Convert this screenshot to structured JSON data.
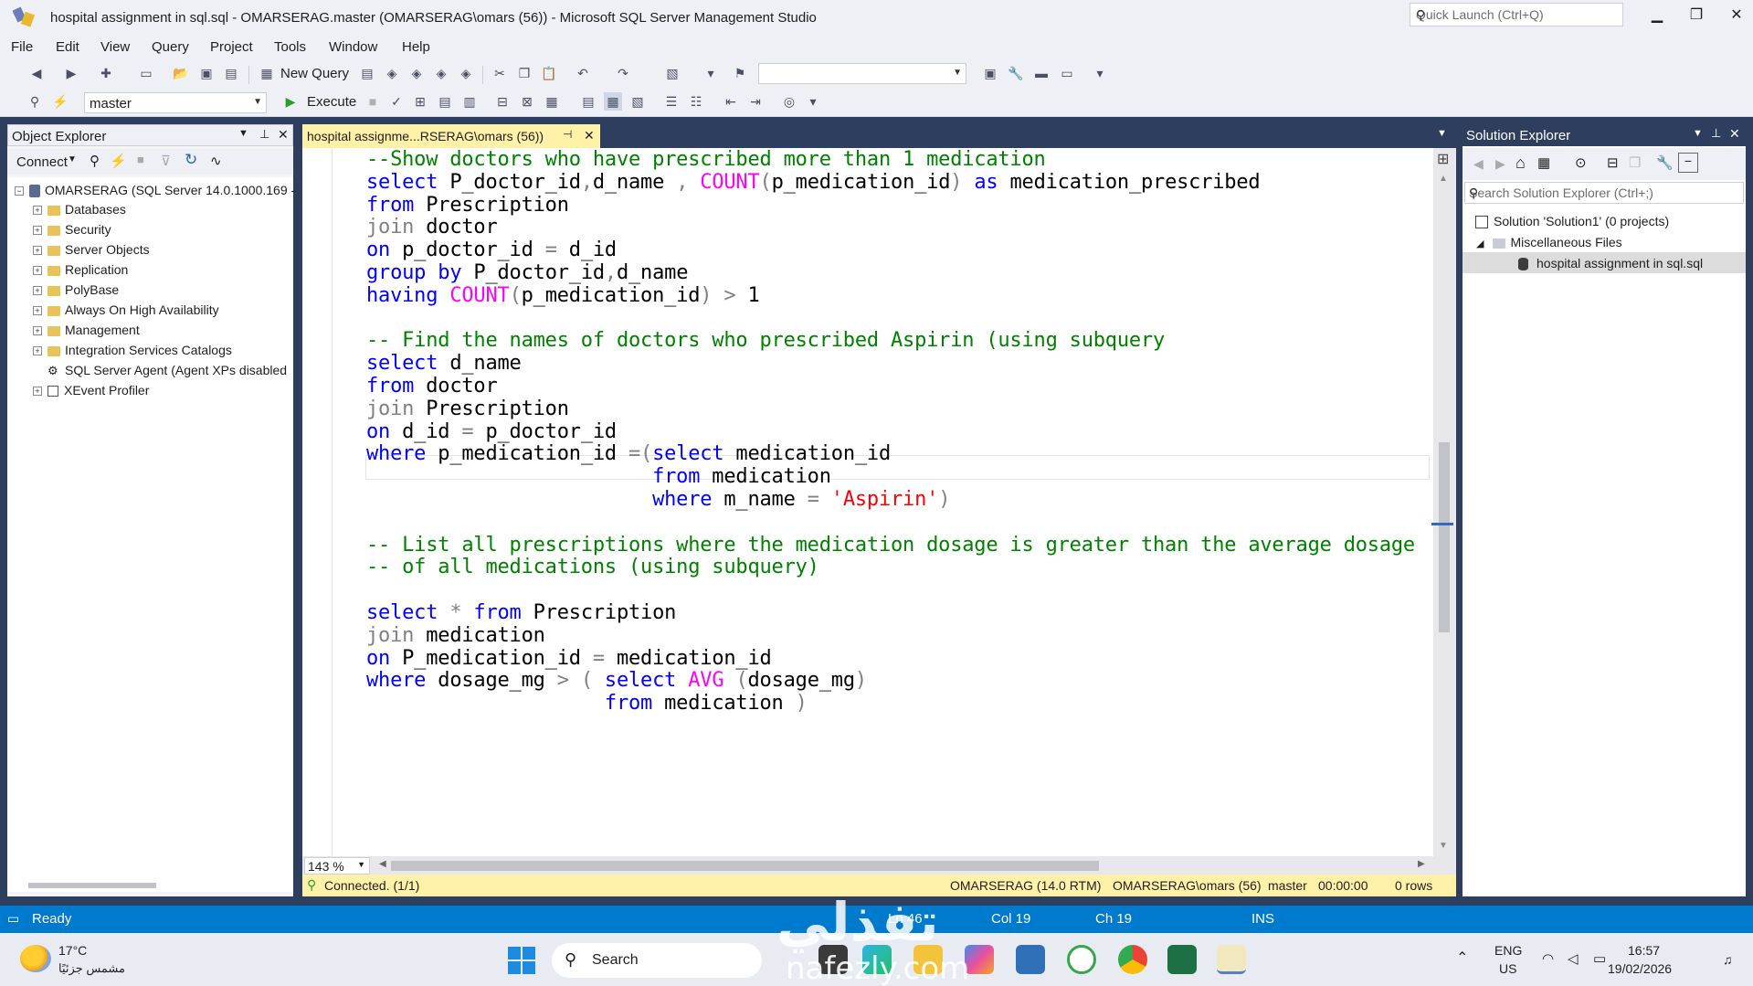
{
  "window": {
    "title": "hospital assignment in sql.sql - OMARSERAG.master (OMARSERAG\\omars (56)) - Microsoft SQL Server Management Studio",
    "quick_launch_placeholder": "Quick Launch (Ctrl+Q)"
  },
  "menu": [
    "File",
    "Edit",
    "View",
    "Query",
    "Project",
    "Tools",
    "Window",
    "Help"
  ],
  "toolbar": {
    "new_query_label": "New Query",
    "execute_label": "Execute",
    "database_value": "master"
  },
  "object_explorer": {
    "title": "Object Explorer",
    "connect_label": "Connect",
    "server_node": "OMARSERAG (SQL Server 14.0.1000.169 -",
    "nodes": [
      "Databases",
      "Security",
      "Server Objects",
      "Replication",
      "PolyBase",
      "Always On High Availability",
      "Management",
      "Integration Services Catalogs",
      "SQL Server Agent (Agent XPs disabled",
      "XEvent Profiler"
    ]
  },
  "editor": {
    "tab_label": "hospital assignme...RSERAG\\omars (56))",
    "zoom": "143 %",
    "connection_status": "Connected. (1/1)",
    "server_info": "OMARSERAG (14.0 RTM)",
    "user_info": "OMARSERAG\\omars (56)",
    "database": "master",
    "elapsed": "00:00:00",
    "rows": "0 rows",
    "lines": [
      [
        {
          "t": "--Show doctors who have prescribed more than 1 medication",
          "c": "cm"
        }
      ],
      [
        {
          "t": "select",
          "c": "kw"
        },
        {
          "t": " P_doctor_id",
          "c": "tx"
        },
        {
          "t": ",",
          "c": "gr"
        },
        {
          "t": "d_name ",
          "c": "tx"
        },
        {
          "t": ", ",
          "c": "gr"
        },
        {
          "t": "COUNT",
          "c": "fn"
        },
        {
          "t": "(",
          "c": "gr"
        },
        {
          "t": "p_medication_id",
          "c": "tx"
        },
        {
          "t": ")",
          "c": "gr"
        },
        {
          "t": " as",
          "c": "kw"
        },
        {
          "t": " medication_prescribed",
          "c": "tx"
        }
      ],
      [
        {
          "t": "from",
          "c": "kw"
        },
        {
          "t": " Prescription",
          "c": "tx"
        }
      ],
      [
        {
          "t": "join",
          "c": "gr"
        },
        {
          "t": " doctor",
          "c": "tx"
        }
      ],
      [
        {
          "t": "on",
          "c": "kw"
        },
        {
          "t": " p_doctor_id ",
          "c": "tx"
        },
        {
          "t": "=",
          "c": "gr"
        },
        {
          "t": " d_id",
          "c": "tx"
        }
      ],
      [
        {
          "t": "group by",
          "c": "kw"
        },
        {
          "t": " P_doctor_id",
          "c": "tx"
        },
        {
          "t": ",",
          "c": "gr"
        },
        {
          "t": "d_name",
          "c": "tx"
        }
      ],
      [
        {
          "t": "having",
          "c": "kw"
        },
        {
          "t": " COUNT",
          "c": "fn"
        },
        {
          "t": "(",
          "c": "gr"
        },
        {
          "t": "p_medication_id",
          "c": "tx"
        },
        {
          "t": ")",
          "c": "gr"
        },
        {
          "t": " > ",
          "c": "gr"
        },
        {
          "t": "1",
          "c": "tx"
        }
      ],
      [],
      [
        {
          "t": "-- Find the names of doctors who prescribed Aspirin (using subquery",
          "c": "cm"
        }
      ],
      [
        {
          "t": "select",
          "c": "kw"
        },
        {
          "t": " d_name",
          "c": "tx"
        }
      ],
      [
        {
          "t": "from",
          "c": "kw"
        },
        {
          "t": " doctor",
          "c": "tx"
        }
      ],
      [
        {
          "t": "join",
          "c": "gr"
        },
        {
          "t": " Prescription",
          "c": "tx"
        }
      ],
      [
        {
          "t": "on",
          "c": "kw"
        },
        {
          "t": " d_id ",
          "c": "tx"
        },
        {
          "t": "=",
          "c": "gr"
        },
        {
          "t": " p_doctor_id",
          "c": "tx"
        }
      ],
      [
        {
          "t": "where",
          "c": "kw"
        },
        {
          "t": " p_medication_id ",
          "c": "tx"
        },
        {
          "t": "=(",
          "c": "gr"
        },
        {
          "t": "select",
          "c": "kw"
        },
        {
          "t": " medication_id",
          "c": "tx"
        }
      ],
      [
        {
          "t": "                        from",
          "c": "kw"
        },
        {
          "t": " medication",
          "c": "tx"
        }
      ],
      [
        {
          "t": "                        where",
          "c": "kw"
        },
        {
          "t": " m_name ",
          "c": "tx"
        },
        {
          "t": "= ",
          "c": "gr"
        },
        {
          "t": "'Aspirin'",
          "c": "st"
        },
        {
          "t": ")",
          "c": "gr"
        }
      ],
      [],
      [
        {
          "t": "-- List all prescriptions where the medication dosage is greater than the average dosage",
          "c": "cm"
        }
      ],
      [
        {
          "t": "-- of all medications (using subquery)",
          "c": "cm"
        }
      ],
      [],
      [
        {
          "t": "select",
          "c": "kw"
        },
        {
          "t": " * ",
          "c": "gr"
        },
        {
          "t": "from",
          "c": "kw"
        },
        {
          "t": " Prescription",
          "c": "tx"
        }
      ],
      [
        {
          "t": "join",
          "c": "gr"
        },
        {
          "t": " medication",
          "c": "tx"
        }
      ],
      [
        {
          "t": "on",
          "c": "kw"
        },
        {
          "t": " P_medication_id ",
          "c": "tx"
        },
        {
          "t": "=",
          "c": "gr"
        },
        {
          "t": " medication_id",
          "c": "tx"
        }
      ],
      [
        {
          "t": "where",
          "c": "kw"
        },
        {
          "t": " dosage_mg ",
          "c": "tx"
        },
        {
          "t": "> ( ",
          "c": "gr"
        },
        {
          "t": "select",
          "c": "kw"
        },
        {
          "t": " AVG ",
          "c": "fn"
        },
        {
          "t": "(",
          "c": "gr"
        },
        {
          "t": "dosage_mg",
          "c": "tx"
        },
        {
          "t": ")",
          "c": "gr"
        }
      ],
      [
        {
          "t": "                    from",
          "c": "kw"
        },
        {
          "t": " medication ",
          "c": "tx"
        },
        {
          "t": ")",
          "c": "gr"
        }
      ]
    ]
  },
  "solution_explorer": {
    "title": "Solution Explorer",
    "search_placeholder": "Search Solution Explorer (Ctrl+;)",
    "solution": "Solution 'Solution1' (0 projects)",
    "misc_folder": "Miscellaneous Files",
    "file": "hospital assignment in sql.sql"
  },
  "status_bar": {
    "ready": "Ready",
    "line": "Ln 46",
    "col": "Col 19",
    "ch": "Ch 19",
    "mode": "INS"
  },
  "taskbar": {
    "weather_temp": "17°C",
    "weather_desc": "مشمس جزئيًا",
    "search_label": "Search",
    "lang_top": "ENG",
    "lang_bottom": "US",
    "time": "16:57",
    "date": "19/02/2026"
  },
  "watermark": {
    "arabic": "تفذلي",
    "latin": "nafezly.com"
  }
}
